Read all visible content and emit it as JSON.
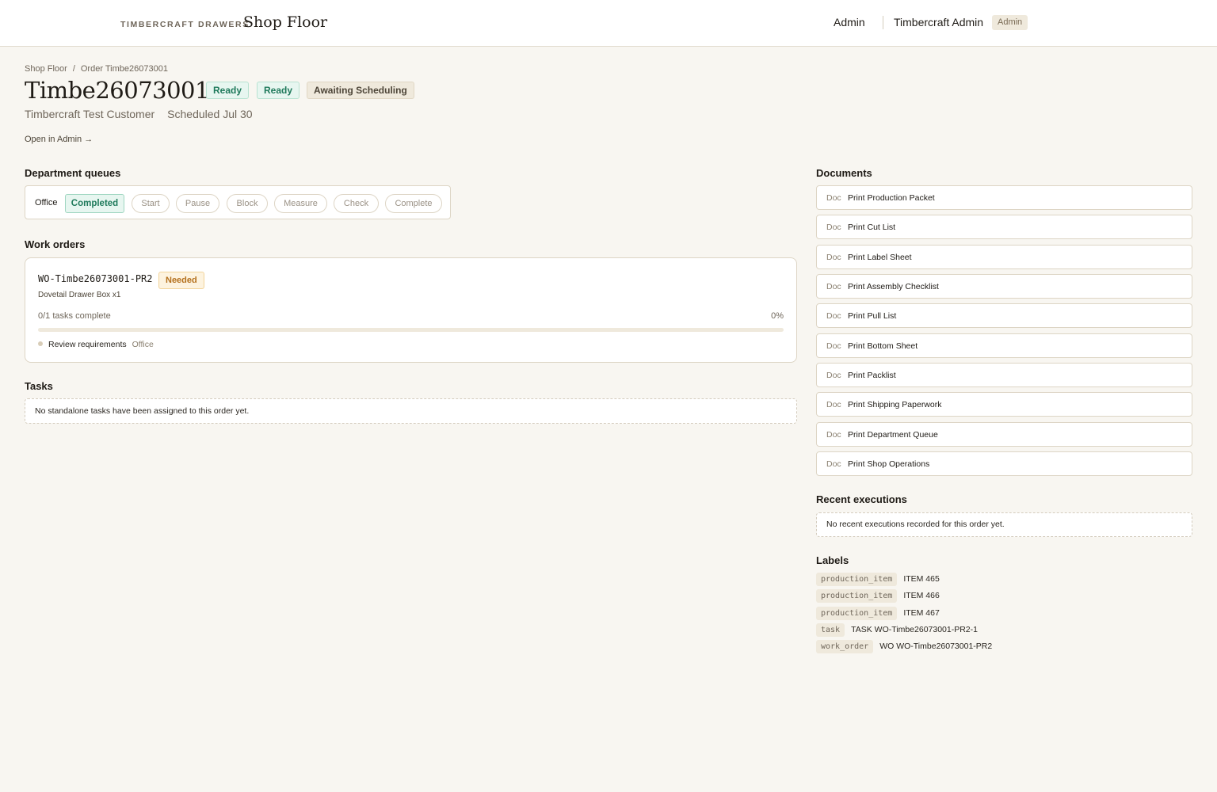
{
  "header": {
    "brand_small": "TIMBERCRAFT DRAWERS",
    "brand_big": "Shop Floor",
    "nav_admin": "Admin",
    "user_name": "Timbercraft Admin",
    "user_role": "Admin"
  },
  "breadcrumb": {
    "root": "Shop Floor",
    "separator": "/",
    "current": "Order Timbe26073001"
  },
  "order": {
    "title": "Timbe26073001",
    "badges": [
      "Ready",
      "Ready",
      "Awaiting Scheduling"
    ],
    "customer": "Timbercraft Test Customer",
    "scheduled": "Scheduled Jul 30",
    "open_admin": "Open in Admin →"
  },
  "department_queues": {
    "heading": "Department queues",
    "department": "Office",
    "status": "Completed",
    "actions": [
      "Start",
      "Pause",
      "Block",
      "Measure",
      "Check",
      "Complete"
    ]
  },
  "work_orders": {
    "heading": "Work orders",
    "items": [
      {
        "code": "WO-Timbe26073001-PR2",
        "status": "Needed",
        "item": "Dovetail Drawer Box x1",
        "progress_text": "0/1 tasks complete",
        "percent_text": "0%",
        "progress_fraction": 0,
        "task": {
          "name": "Review requirements",
          "department": "Office"
        }
      }
    ]
  },
  "tasks": {
    "heading": "Tasks",
    "empty": "No standalone tasks have been assigned to this order yet."
  },
  "documents": {
    "heading": "Documents",
    "tag": "Doc",
    "items": [
      "Print Production Packet",
      "Print Cut List",
      "Print Label Sheet",
      "Print Assembly Checklist",
      "Print Pull List",
      "Print Bottom Sheet",
      "Print Packlist",
      "Print Shipping Paperwork",
      "Print Department Queue",
      "Print Shop Operations"
    ]
  },
  "recent_executions": {
    "heading": "Recent executions",
    "empty": "No recent executions recorded for this order yet."
  },
  "labels": {
    "heading": "Labels",
    "items": [
      {
        "key": "production_item",
        "value": "ITEM 465"
      },
      {
        "key": "production_item",
        "value": "ITEM 466"
      },
      {
        "key": "production_item",
        "value": "ITEM 467"
      },
      {
        "key": "task",
        "value": "TASK WO-Timbe26073001-PR2-1"
      },
      {
        "key": "work_order",
        "value": "WO WO-Timbe26073001-PR2"
      }
    ]
  },
  "colors": {
    "background": "#f8f6f1",
    "ready_green": "#1f7a5b",
    "needed_amber": "#b4701c"
  }
}
